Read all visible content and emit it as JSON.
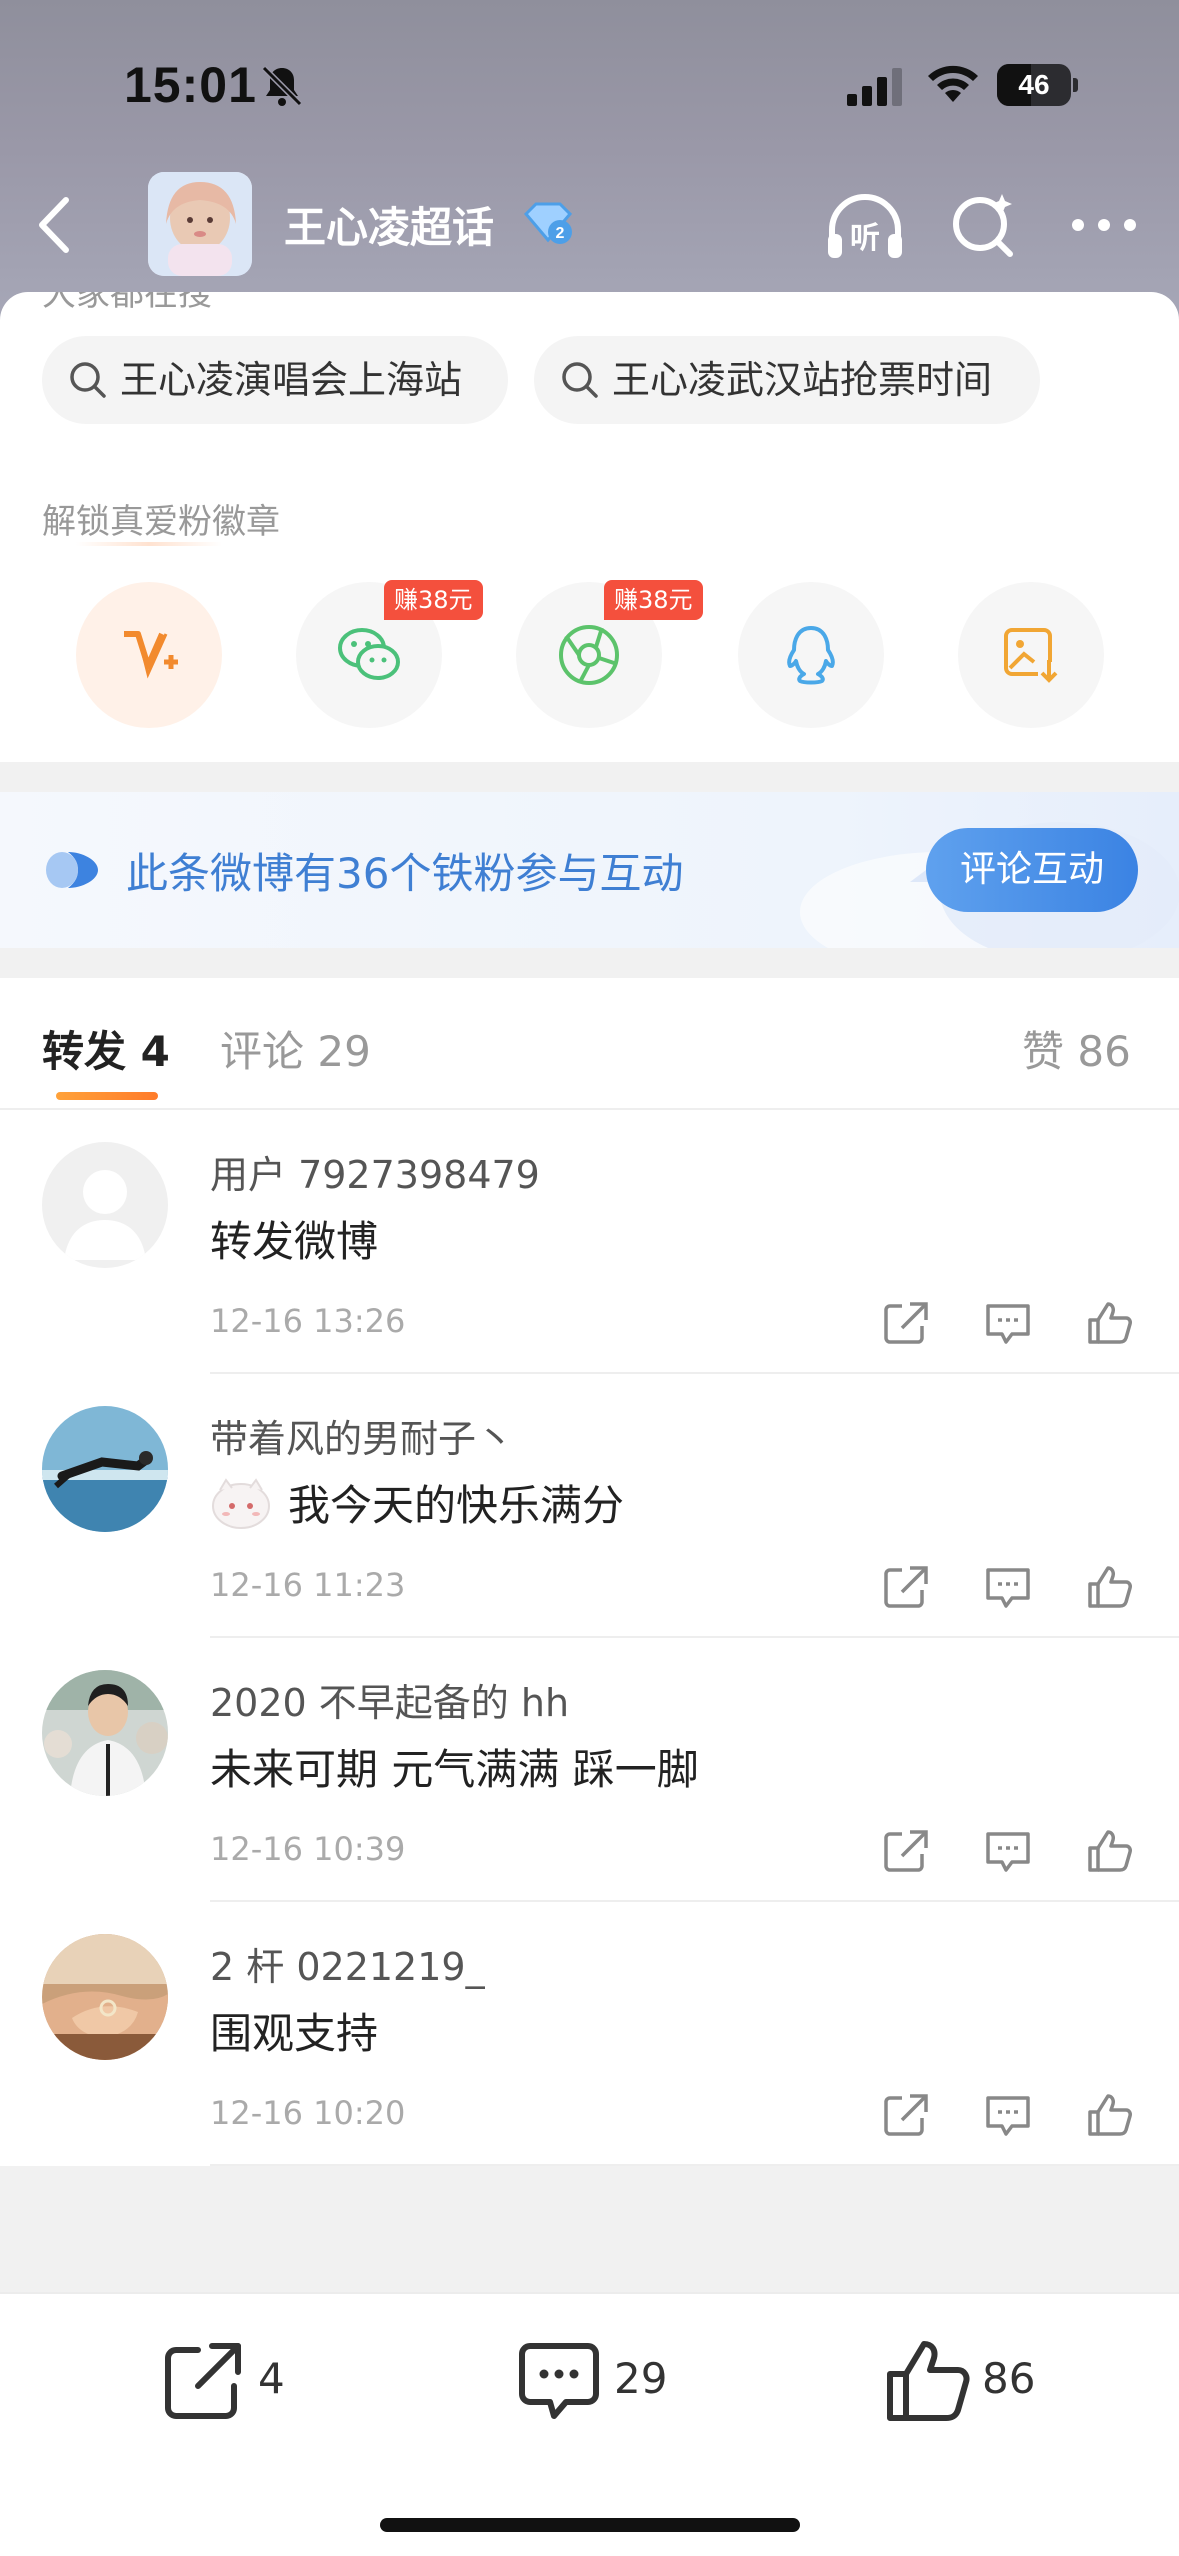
{
  "status_bar": {
    "time": "15:01",
    "battery": "46",
    "battery_level": 0.46
  },
  "nav": {
    "title": "王心凌超话",
    "back_icon": "chevron-left-icon",
    "listen_label": "听",
    "search_icon": "search-sparkle-icon",
    "more_icon": "ellipsis-icon"
  },
  "hot_search": {
    "section_title": "大家都在搜",
    "items": [
      "王心凌演唱会上海站",
      "王心凌武汉站抢票时间"
    ]
  },
  "badges": {
    "title": "解锁真爱粉徽章",
    "items": [
      {
        "icon": "vplus-icon",
        "active": true
      },
      {
        "icon": "wechat-icon",
        "tag": "赚38元"
      },
      {
        "icon": "moments-icon",
        "tag": "赚38元"
      },
      {
        "icon": "qq-icon"
      },
      {
        "icon": "save-image-icon"
      }
    ]
  },
  "fan_banner": {
    "text": "此条微博有36个铁粉参与互动",
    "button": "评论互动"
  },
  "tabs": {
    "repost": "转发 4",
    "comment": "评论 29",
    "like": "赞 86"
  },
  "reposts": [
    {
      "name": "用户 7927398479",
      "content": "转发微博",
      "time": "12-16 13:26"
    },
    {
      "name": "带着风的男耐子丶",
      "content": "我今天的快乐满分",
      "time": "12-16 11:23"
    },
    {
      "name": "2020 不早起备的 hh",
      "content": "未来可期 元气满满 踩一脚",
      "time": "12-16 10:39"
    },
    {
      "name": "2 杆 0221219_",
      "content": "围观支持",
      "time": "12-16 10:20"
    }
  ],
  "bottom_bar": {
    "repost_count": "4",
    "comment_count": "29",
    "like_count": "86"
  },
  "colors": {
    "accent_orange": "#ff8a2a",
    "link_blue": "#3f7fd3",
    "earn_red": "#f4503d"
  }
}
